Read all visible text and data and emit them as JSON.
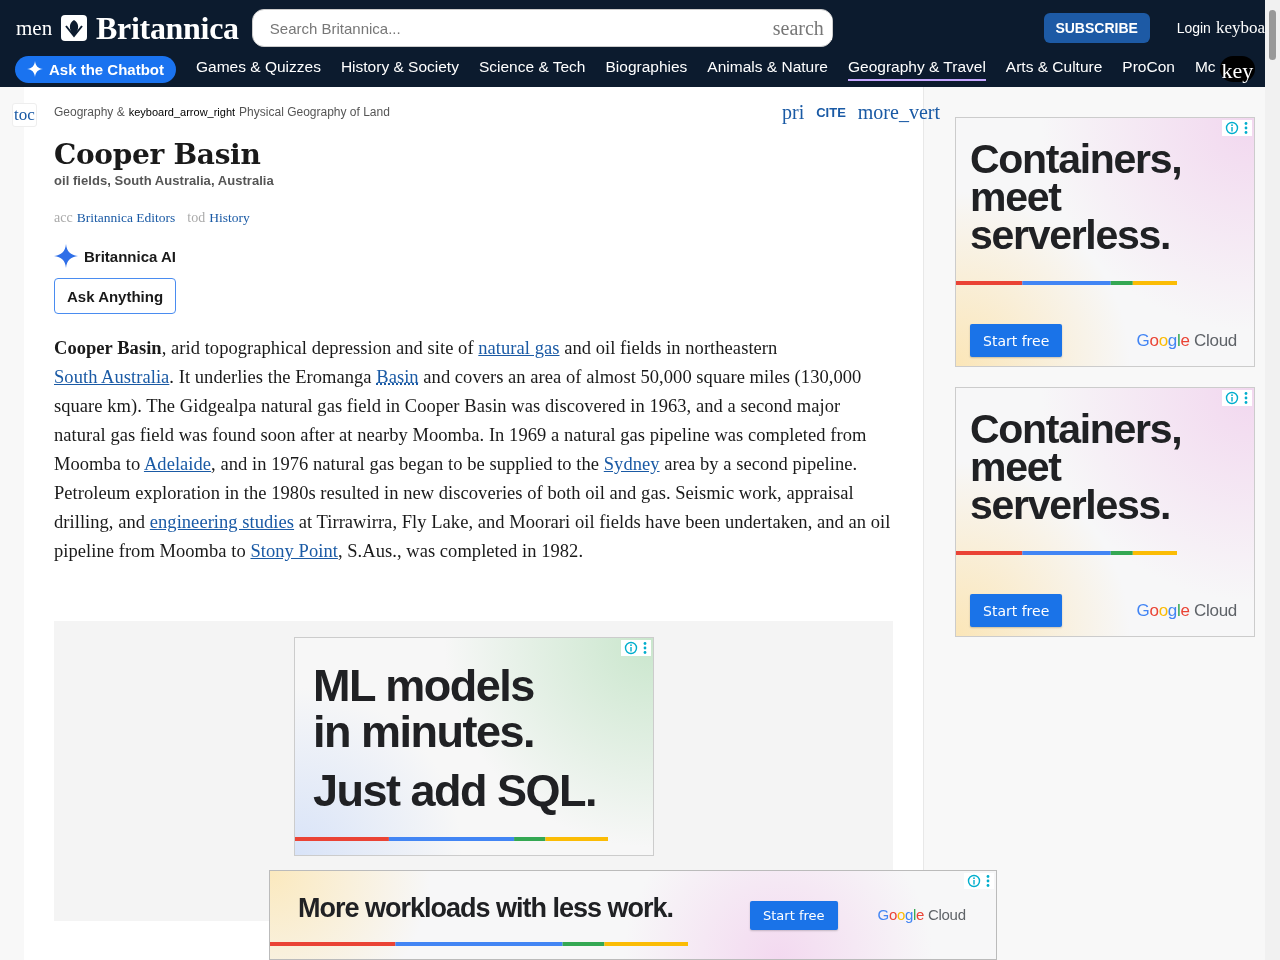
{
  "header": {
    "menu": "men",
    "logo": "Britannica",
    "search": {
      "placeholder": "Search Britannica...",
      "button": "search"
    },
    "subscribe": "SUBSCRIBE",
    "login": "Login",
    "account": "keyboa",
    "chatbot": "Ask the Chatbot",
    "nav": [
      {
        "label": "Games & Quizzes",
        "selected": false
      },
      {
        "label": "History & Society",
        "selected": false
      },
      {
        "label": "Science & Tech",
        "selected": false
      },
      {
        "label": "Biographies",
        "selected": false
      },
      {
        "label": "Animals & Nature",
        "selected": false
      },
      {
        "label": "Geography & Travel",
        "selected": true
      },
      {
        "label": "Arts & Culture",
        "selected": false
      },
      {
        "label": "ProCon",
        "selected": false
      },
      {
        "label": "Mc",
        "selected": false
      }
    ],
    "nav_more": "key"
  },
  "toc": "toc",
  "breadcrumb": [
    "Geography &",
    "keyboard_arrow_right",
    "Physical Geography of Land"
  ],
  "tools": [
    {
      "label": "pri",
      "kind": "icon"
    },
    {
      "label": "CITE",
      "kind": "button"
    },
    {
      "label": "more_vert",
      "kind": "icon"
    }
  ],
  "title": "Cooper Basin",
  "subtitle": "oil fields, South Australia, Australia",
  "byline": [
    {
      "label": "acc",
      "kind": "icon"
    },
    {
      "label": "Britannica Editors",
      "kind": "link"
    },
    {
      "label": "tod",
      "kind": "icon"
    },
    {
      "label": "History",
      "kind": "link"
    }
  ],
  "ai": {
    "label": "Britannica AI",
    "button": "Ask Anything"
  },
  "paragraph": [
    {
      "kind": "bold",
      "text": "Cooper Basin"
    },
    {
      "kind": "text",
      "text": ", arid topographical depression and site of "
    },
    {
      "kind": "link",
      "text": "natural gas"
    },
    {
      "kind": "text",
      "text": " and oil fields in northeastern "
    },
    {
      "kind": "link",
      "text": "South Australia"
    },
    {
      "kind": "text",
      "text": ". It underlies the Eromanga "
    },
    {
      "kind": "term",
      "text": "Basin"
    },
    {
      "kind": "text",
      "text": " and covers an area of almost 50,000 square miles (130,000 square km). The Gidgealpa natural gas field in Cooper Basin was discovered in 1963, and a second major natural gas field was found soon after at nearby Moomba. In 1969 a natural gas pipeline was completed from Moomba to "
    },
    {
      "kind": "link",
      "text": "Adelaide"
    },
    {
      "kind": "text",
      "text": ", and in 1976 natural gas began to be supplied to the "
    },
    {
      "kind": "link",
      "text": "Sydney"
    },
    {
      "kind": "text",
      "text": " area by a second pipeline. Petroleum exploration in the 1980s resulted in new discoveries of both oil and gas. Seismic work, appraisal drilling, and "
    },
    {
      "kind": "link",
      "text": "engineering studies"
    },
    {
      "kind": "text",
      "text": " at Tirrawirra, Fly Lake, and Moorari oil fields have been undertaken, and an oil pipeline from Moomba to "
    },
    {
      "kind": "link",
      "text": "Stony Point"
    },
    {
      "kind": "text",
      "text": ", S.Aus., was completed in 1982."
    }
  ],
  "side_ads": [
    {
      "headline": [
        "Containers,",
        "meet",
        "serverless."
      ],
      "button": "Start free",
      "brand": [
        "Google",
        "Cloud"
      ]
    },
    {
      "headline": [
        "Containers,",
        "meet",
        "serverless."
      ],
      "button": "Start free",
      "brand": [
        "Google",
        "Cloud"
      ]
    }
  ],
  "inline_ad": {
    "headline": [
      "ML models",
      "in minutes.",
      "Just add SQL."
    ]
  },
  "sticky_ad": {
    "headline": "More workloads with less work.",
    "button": "Start free",
    "brand": [
      "Google",
      "Cloud"
    ]
  }
}
